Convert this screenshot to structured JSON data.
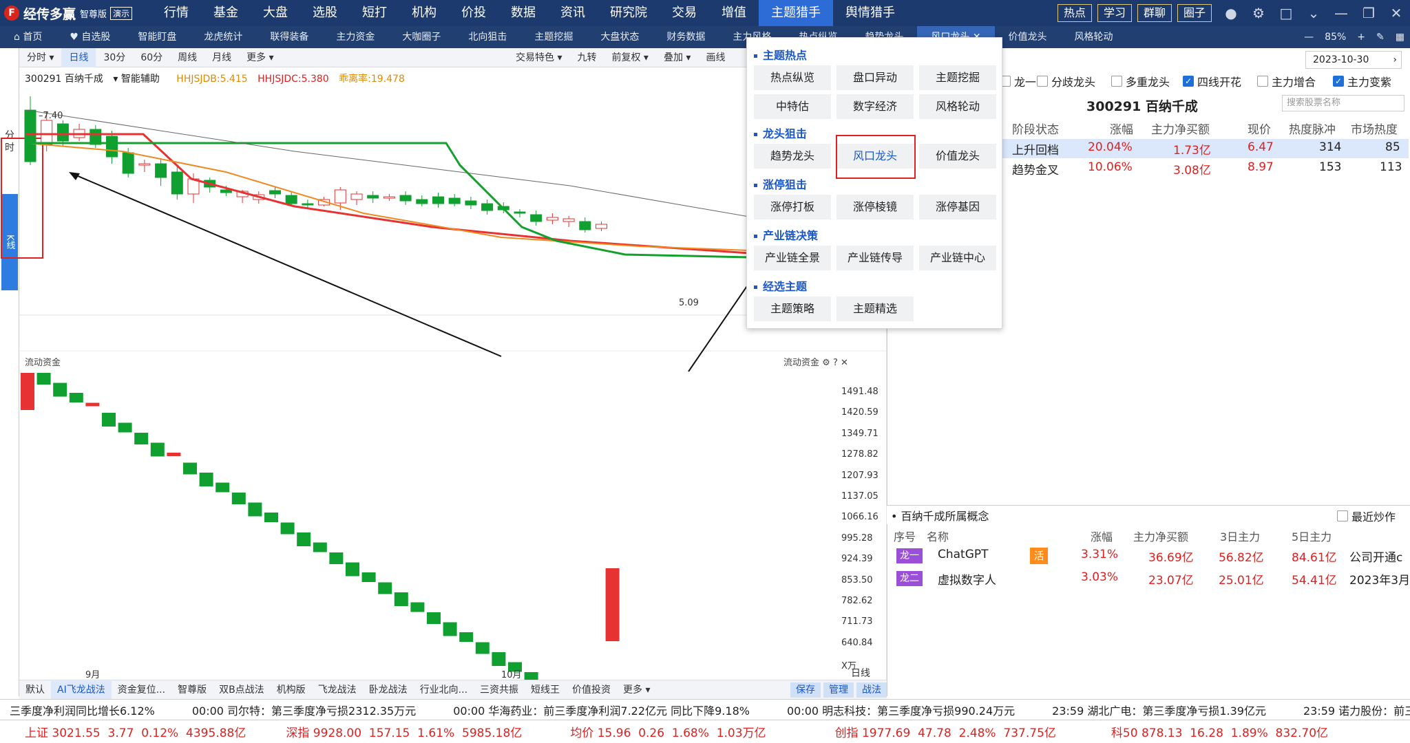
{
  "app": {
    "logo_mark": "F",
    "name": "经传多赢",
    "edition": "智尊版",
    "demo": "演示"
  },
  "top_menu": [
    "行情",
    "基金",
    "大盘",
    "选股",
    "短打",
    "机构",
    "价投",
    "数据",
    "资讯",
    "研究院",
    "交易",
    "增值",
    "主题猎手",
    "舆情猎手"
  ],
  "top_right_buttons": [
    "热点",
    "学习",
    "群聊",
    "圈子"
  ],
  "tabs2": [
    "首页",
    "自选股",
    "智能盯盘",
    "龙虎统计",
    "联得装备",
    "主力资金",
    "大咖圈子",
    "北向狙击",
    "主题挖掘",
    "大盘状态",
    "财务数据",
    "主力风格",
    "热点纵览",
    "趋势龙头",
    "风口龙头",
    "价值龙头",
    "风格轮动"
  ],
  "tabs2_zoom": "85%",
  "left_tabs": {
    "fenshi": "分时",
    "kline": "K线"
  },
  "chart_toolbar": [
    "分时",
    "日线",
    "30分",
    "60分",
    "周线",
    "月线",
    "更多"
  ],
  "chart_toolbar_right": [
    "交易特色",
    "九转",
    "前复权",
    "叠加",
    "画线"
  ],
  "chart_info": {
    "code_name": "300291 百纳千成",
    "assist": "智能辅助",
    "hhjsjdb": "HHJSJDB:5.415",
    "hhjsjdc": "HHJSJDC:5.380",
    "deviation": "乖离率:19.478"
  },
  "price_labels": {
    "high": "7.40",
    "low": "5.09"
  },
  "sub_title": "流动资金",
  "right_axis": [
    "1491.48",
    "1420.59",
    "1349.71",
    "1278.82",
    "1207.93",
    "1137.05",
    "1066.16",
    "995.28",
    "924.39",
    "853.50",
    "782.62",
    "711.73",
    "640.84",
    "X万"
  ],
  "x_labels": [
    "9月",
    "10月"
  ],
  "bottom_tools": [
    "默认",
    "AI飞龙战法",
    "资金复位...",
    "智尊版",
    "双B点战法",
    "机构版",
    "飞龙战法",
    "卧龙战法",
    "行业北向...",
    "三资共振",
    "短线王",
    "价值投资",
    "更多"
  ],
  "bottom_right": [
    "保存",
    "管理",
    "战法"
  ],
  "bottom_mode": "日线",
  "dropdown": {
    "sections": [
      "主题热点",
      "龙头狙击",
      "涨停狙击",
      "产业链决策",
      "经选主题"
    ],
    "row1": [
      "热点纵览",
      "盘口异动",
      "主题挖掘"
    ],
    "row2": [
      "中特估",
      "数字经济",
      "风格轮动"
    ],
    "row3": [
      "趋势龙头",
      "风口龙头",
      "价值龙头"
    ],
    "row4": [
      "涨停打板",
      "涨停棱镜",
      "涨停基因"
    ],
    "row5": [
      "产业链全景",
      "产业链传导",
      "产业链中心"
    ],
    "row6": [
      "主题策略",
      "主题精选"
    ]
  },
  "right_panel": {
    "date": "2023-10-30",
    "filters": [
      {
        "label": "龙一",
        "checked": false
      },
      {
        "label": "分歧龙头",
        "checked": false
      },
      {
        "label": "多重龙头",
        "checked": false
      },
      {
        "label": "四线开花",
        "checked": true
      },
      {
        "label": "主力增合",
        "checked": false
      },
      {
        "label": "主力变紫",
        "checked": true
      }
    ],
    "stock_title": "300291 百纳千成",
    "search_placeholder": "搜索股票名称",
    "headers": [
      "阶段状态",
      "涨幅",
      "主力净买额",
      "现价",
      "热度脉冲",
      "市场热度"
    ],
    "rows": [
      [
        "上升回档",
        "20.04%",
        "1.73亿",
        "6.47",
        "314",
        "85"
      ],
      [
        "趋势金叉",
        "10.06%",
        "3.08亿",
        "8.97",
        "153",
        "113"
      ]
    ],
    "concept_title": "百纳千成所属概念",
    "recent_label": "最近炒作",
    "concept_headers": [
      "序号",
      "名称",
      "涨幅",
      "主力净买额",
      "3日主力",
      "5日主力"
    ],
    "concepts": [
      {
        "rank": "龙一",
        "name": "ChatGPT",
        "tag": "活",
        "chg": "3.31%",
        "net": "36.69亿",
        "d3": "56.82亿",
        "d5": "84.61亿",
        "note": "公司开通c"
      },
      {
        "rank": "龙二",
        "name": "虚拟数字人",
        "tag": "",
        "chg": "3.03%",
        "net": "23.07亿",
        "d3": "25.01亿",
        "d5": "54.41亿",
        "note": "2023年3月"
      }
    ]
  },
  "news": [
    "三季度净利润同比增长6.12%",
    "00:00 司尔特：第三季度净亏损2312.35万元",
    "00:00 华海药业：前三季度净利润7.22亿元 同比下降9.18%",
    "00:00 明志科技：第三季度净亏损990.24万元",
    "23:59 湖北广电：第三季度净亏损1.39亿元",
    "23:59 诺力股份：前三"
  ],
  "indices": [
    {
      "name": "上证",
      "val": "3021.55",
      "chg": "3.77",
      "pct": "0.12%",
      "amt": "4395.88亿"
    },
    {
      "name": "深指",
      "val": "9928.00",
      "chg": "157.15",
      "pct": "1.61%",
      "amt": "5985.18亿"
    },
    {
      "name": "均价",
      "val": "15.96",
      "chg": "0.26",
      "pct": "1.68%",
      "amt": "1.03万亿"
    },
    {
      "name": "创指",
      "val": "1977.69",
      "chg": "47.78",
      "pct": "2.48%",
      "amt": "737.75亿"
    },
    {
      "name": "科50",
      "val": "878.13",
      "chg": "16.28",
      "pct": "1.89%",
      "amt": "832.70亿"
    }
  ],
  "colors": {
    "up": "#e63232",
    "down": "#0fa030",
    "accent": "#1a57c7",
    "nav": "#1d3a6e"
  }
}
